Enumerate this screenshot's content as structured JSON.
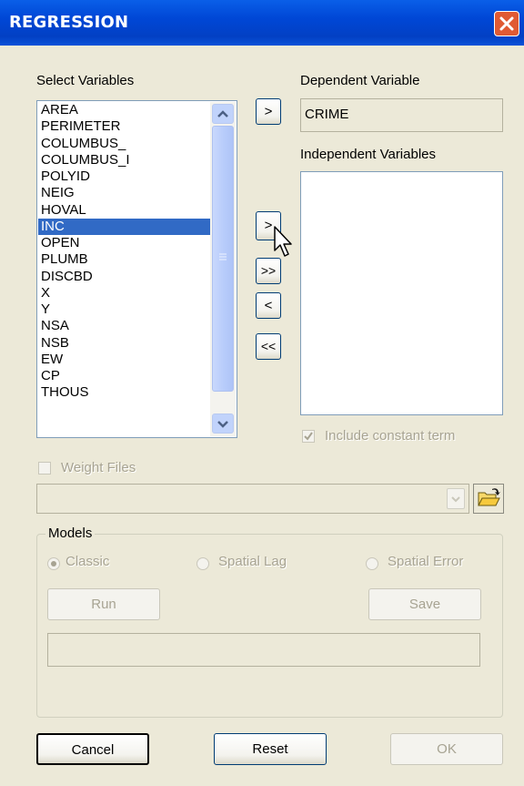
{
  "window": {
    "title": "REGRESSION"
  },
  "labels": {
    "select_variables": "Select Variables",
    "dependent_variable": "Dependent Variable",
    "independent_variables": "Independent Variables"
  },
  "dependent_value": "CRIME",
  "variables": [
    "AREA",
    "PERIMETER",
    "COLUMBUS_",
    "COLUMBUS_I",
    "POLYID",
    "NEIG",
    "HOVAL",
    "INC",
    "OPEN",
    "PLUMB",
    "DISCBD",
    "X",
    "Y",
    "NSA",
    "NSB",
    "EW",
    "CP",
    "THOUS"
  ],
  "selected_variable": "INC",
  "move_buttons": {
    "add_dependent": ">",
    "add_independent": ">",
    "add_all": ">>",
    "remove": "<",
    "remove_all": "<<"
  },
  "include_constant": {
    "label": "Include constant term",
    "checked": true
  },
  "weight_files": {
    "label": "Weight Files",
    "checked": false,
    "value": ""
  },
  "models": {
    "legend": "Models",
    "options": [
      "Classic",
      "Spatial Lag",
      "Spatial Error"
    ],
    "selected": "Classic",
    "run_label": "Run",
    "save_label": "Save",
    "progress": 0
  },
  "footer": {
    "cancel_label": "Cancel",
    "reset_label": "Reset",
    "ok_label": "OK"
  },
  "colors": {
    "titlebar": "#0047d6",
    "selection": "#316ac5",
    "dialog_bg": "#ece9d8"
  }
}
